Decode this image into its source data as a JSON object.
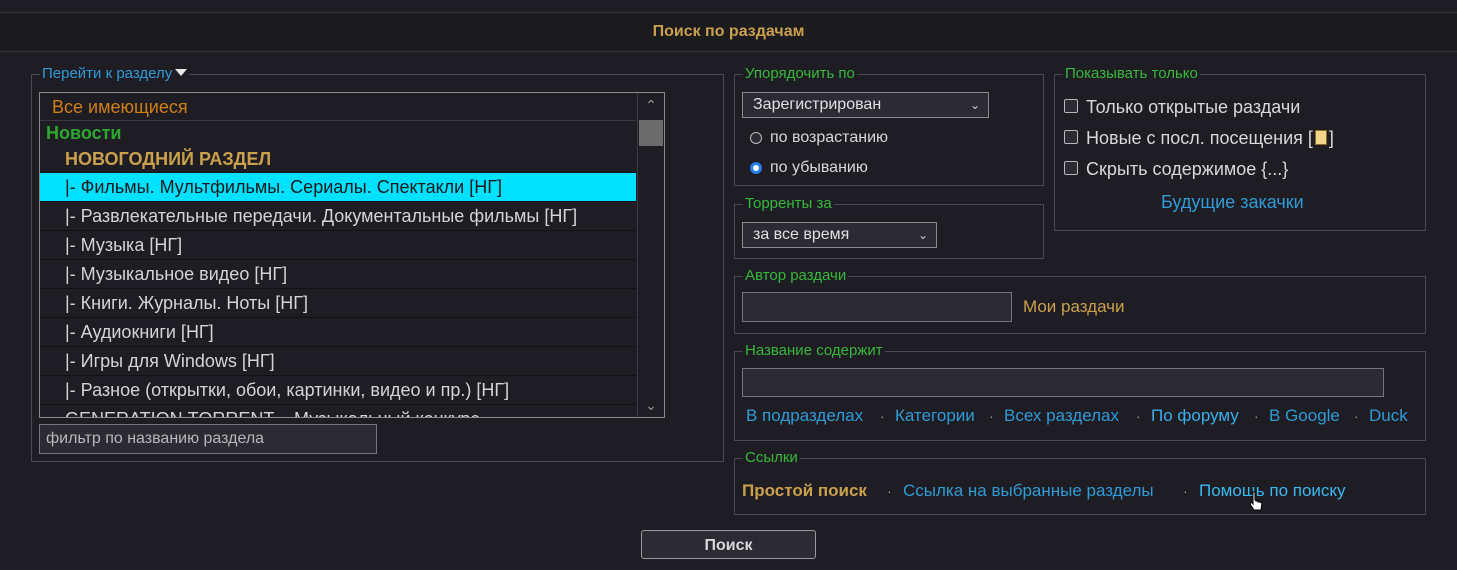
{
  "header": {
    "title": "Поиск по раздачам"
  },
  "sections": {
    "legend": "Перейти к разделу",
    "items": [
      "Все имеющиеся",
      "Новости",
      " НОВОГОДНИЙ РАЗДЕЛ ",
      "|- Фильмы. Мультфильмы. Сериалы. Спектакли [НГ]",
      "|- Развлекательные передачи. Документальные фильмы [НГ]",
      "|- Музыка [НГ]",
      "|- Музыкальное видео [НГ]",
      "|- Книги. Журналы. Ноты [НГ]",
      "|- Аудиокниги [НГ]",
      "|- Игры для Windows [НГ]",
      "|- Разное (открытки, обои, картинки, видео и пр.) [НГ]",
      "GENERATION.TORRENT – Музыкальный конкурс"
    ],
    "selected_index": 3,
    "filter_placeholder": "фильтр по названию раздела"
  },
  "order": {
    "legend": "Упорядочить по",
    "select_value": "Зарегистрирован",
    "asc_label": "по возрастанию",
    "desc_label": "по убыванию",
    "selected": "desc"
  },
  "period": {
    "legend": "Торренты за",
    "select_value": "за все время"
  },
  "show_only": {
    "legend": "Показывать только",
    "open_only": "Только открытые раздачи",
    "new_since": "Новые с посл. посещения [",
    "new_since_end": "]",
    "hide_content": "Скрыть содержимое {...}",
    "future_downloads": "Будущие закачки"
  },
  "author": {
    "legend": "Автор раздачи",
    "value": "",
    "my_releases": "Мои раздачи"
  },
  "title_contains": {
    "legend": "Название содержит",
    "value": "",
    "scope_links": [
      "В подразделах",
      "Категории",
      "Всех разделах",
      "По форуму",
      "В Google",
      "Duck"
    ]
  },
  "links": {
    "legend": "Ссылки",
    "simple_search": "Простой поиск",
    "selected_link": "Ссылка на выбранные разделы",
    "help": "Помощь по поиску"
  },
  "search_button": "Поиск",
  "colors": {
    "background": "#1f1d24",
    "accent_gold": "#c9a04b",
    "legend_green": "#36b93a",
    "link_blue": "#2e9bd6",
    "selected_row": "#00e0ff"
  }
}
